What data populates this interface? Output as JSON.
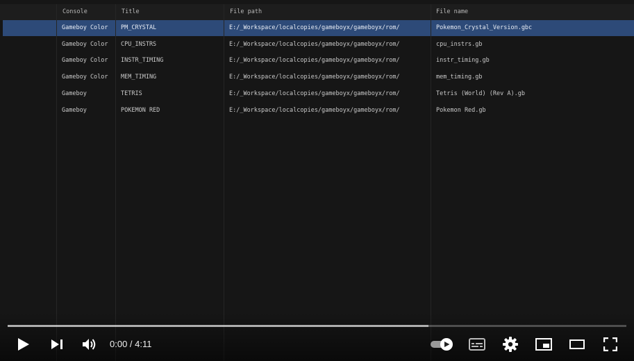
{
  "table": {
    "columns": {
      "console": "Console",
      "title": "Title",
      "file_path": "File path",
      "file_name": "File name"
    },
    "rows": [
      {
        "console": "Gameboy Color",
        "title": "PM_CRYSTAL",
        "file_path": "E:/_Workspace/localcopies/gameboyx/gameboyx/rom/",
        "file_name": "Pokemon_Crystal_Version.gbc",
        "selected": true
      },
      {
        "console": "Gameboy Color",
        "title": "CPU_INSTRS",
        "file_path": "E:/_Workspace/localcopies/gameboyx/gameboyx/rom/",
        "file_name": "cpu_instrs.gb",
        "selected": false
      },
      {
        "console": "Gameboy Color",
        "title": "INSTR_TIMING",
        "file_path": "E:/_Workspace/localcopies/gameboyx/gameboyx/rom/",
        "file_name": "instr_timing.gb",
        "selected": false
      },
      {
        "console": "Gameboy Color",
        "title": "MEM_TIMING",
        "file_path": "E:/_Workspace/localcopies/gameboyx/gameboyx/rom/",
        "file_name": "mem_timing.gb",
        "selected": false
      },
      {
        "console": "Gameboy",
        "title": "TETRIS",
        "file_path": "E:/_Workspace/localcopies/gameboyx/gameboyx/rom/",
        "file_name": "Tetris (World) (Rev A).gb",
        "selected": false
      },
      {
        "console": "Gameboy",
        "title": "POKEMON RED",
        "file_path": "E:/_Workspace/localcopies/gameboyx/gameboyx/rom/",
        "file_name": "Pokemon Red.gb",
        "selected": false
      }
    ]
  },
  "player": {
    "current_time": "0:00",
    "separator": " / ",
    "duration": "4:11",
    "buffered_fraction": 0.68,
    "autoplay_on": true,
    "icons": {
      "play": "play-icon",
      "next": "skip-next-icon",
      "volume": "volume-icon",
      "autoplay": "autoplay-toggle-icon",
      "subtitles": "subtitles-icon",
      "settings": "gear-icon",
      "miniplayer": "miniplayer-icon",
      "theater": "theater-mode-icon",
      "fullscreen": "fullscreen-icon"
    },
    "colors": {
      "selected_row": "#2d4a78",
      "icon": "#ffffff"
    }
  }
}
